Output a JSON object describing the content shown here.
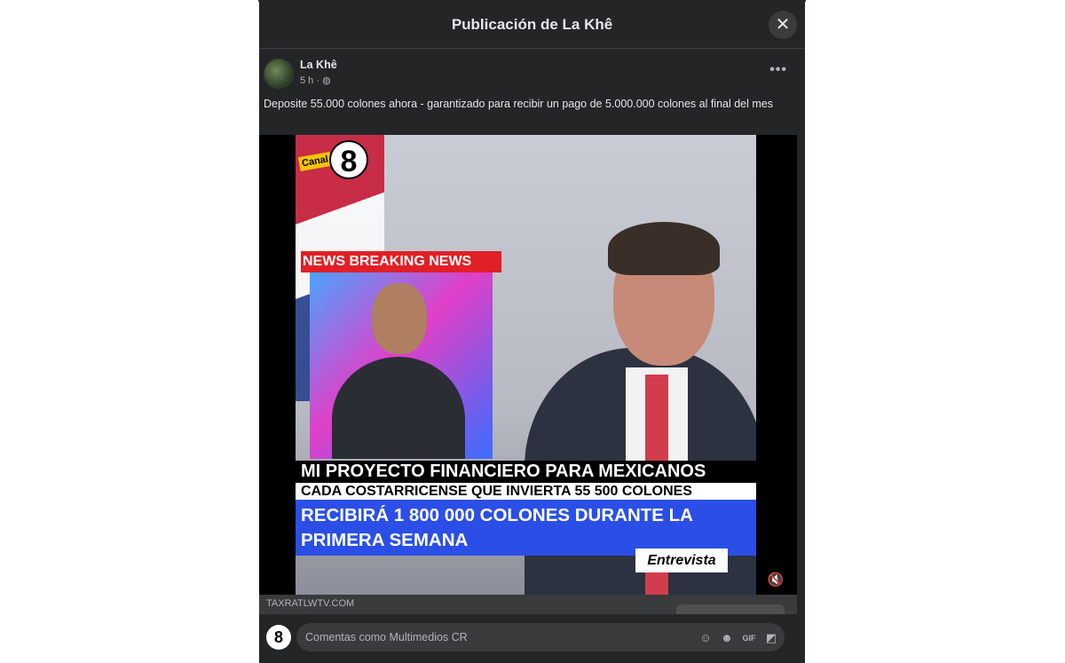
{
  "header": {
    "title": "Publicación de La Khê",
    "close_glyph": "✕"
  },
  "post": {
    "author": "La Khê",
    "meta": "5 h · ",
    "meta_icon": "globe-icon",
    "more_glyph": "•••",
    "text": "Deposite 55.000 colones ahora - garantizado para recibir un pago de 5.000.000 colones al final del mes"
  },
  "video": {
    "logo_text": "Canal",
    "logo_number": "8",
    "breaking": "NEWS   BREAKING NEWS",
    "caption_1": "MI PROYECTO FINANCIERO PARA MEXICANOS",
    "caption_2": "CADA COSTARRICENSE QUE INVIERTA 55 500 COLONES",
    "caption_3": "RECIBIRÁ 1 800 000 COLONES DURANTE LA PRIMERA SEMANA",
    "badge": "Entrevista",
    "mute_glyph": "🔇"
  },
  "link": {
    "domain": "TAXRATLWTV.COM"
  },
  "comment": {
    "avatar_text": "8",
    "placeholder": "Comentas como Multimedios CR",
    "icons": [
      "avatar-sticker-icon",
      "emoji-icon",
      "gif-icon",
      "sticker-icon"
    ]
  },
  "colors": {
    "modal_bg": "#242526",
    "text": "#e4e6eb",
    "caption_blue": "#2b4fe6",
    "breaking_red": "#e11f26"
  }
}
